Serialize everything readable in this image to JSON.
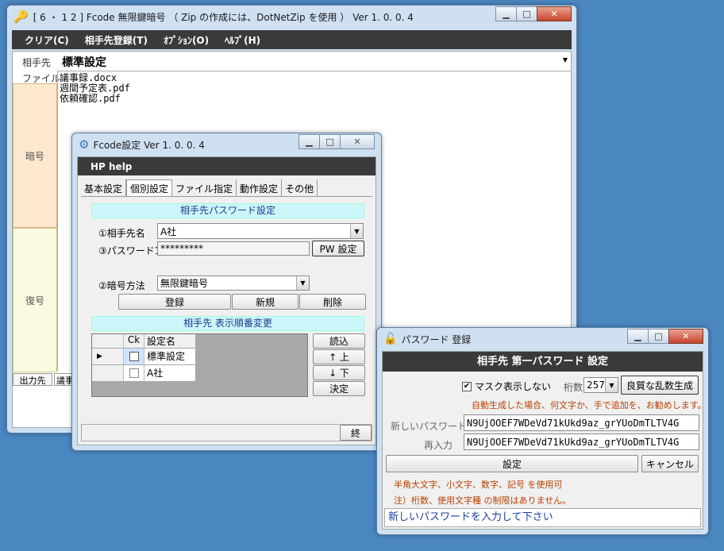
{
  "main": {
    "title": "[ 6 ・ 1 2 ] Fcode 無限鍵暗号 （ Zip の作成には、DotNetZip を使用 ） Ver 1. 0. 0. 4",
    "menu": [
      "クリア(C)",
      "相手先登録(T)",
      "ｵﾌﾟｼｮﾝ(O)",
      "ﾍﾙﾌﾟ(H)"
    ],
    "partner_label": "相手先",
    "partner_value": "標準設定",
    "file_label": "ファイル",
    "files": [
      "議事録.docx",
      "週間予定表.pdf",
      "依頼確認.pdf"
    ],
    "encrypt_label": "暗号",
    "decrypt_label": "復号",
    "output_label": "出力先",
    "output_value": "議事"
  },
  "settings": {
    "title": "Fcode設定  Ver 1. 0. 0. 4",
    "menu": "HP help",
    "tabs": [
      "基本設定",
      "個別設定",
      "ファイル指定",
      "動作設定",
      "その他"
    ],
    "active_tab": 1,
    "section1": "相手先パスワード設定",
    "partner_name_label": "①相手先名",
    "partner_name_value": "A社",
    "password_label": "③パスワード1",
    "password_value": "*********",
    "pw_button": "PW 設定",
    "method_label": "②暗号方法",
    "method_value": "無限鍵暗号",
    "register": "登録",
    "new": "新規",
    "delete": "削除",
    "section2": "相手先 表示順番変更",
    "grid_headers": [
      "Ck",
      "設定名"
    ],
    "grid_rows": [
      "標準設定",
      "A社"
    ],
    "load": "読込",
    "up": "↑ 上",
    "down": "↓ 下",
    "decide": "決定",
    "end": "終"
  },
  "password": {
    "title": "パスワード 登録",
    "header": "相手先 第一パスワード 設定",
    "mask_label": "マスク表示しない",
    "mask_checked": true,
    "digits_label": "桁数",
    "digits_value": "257",
    "generate": "良質な乱数生成",
    "hint": "自動生成した場合、何文字か、手で追加を、お勧めします。",
    "new_label": "新しいパスワード",
    "new_value": "N9UjOOEF7WDeVd71kUkd9az_grYUoDmTLTV4G",
    "confirm_label": "再入力",
    "confirm_value": "N9UjOOEF7WDeVd71kUkd9az_grYUoDmTLTV4G",
    "set": "設定",
    "cancel": "キャンセル",
    "note1": "半角大文字、小文字、数字、記号 を使用可",
    "note2": "注）桁数、使用文字種 の制限はありません。",
    "status": "新しいパスワードを入力して下さい"
  }
}
